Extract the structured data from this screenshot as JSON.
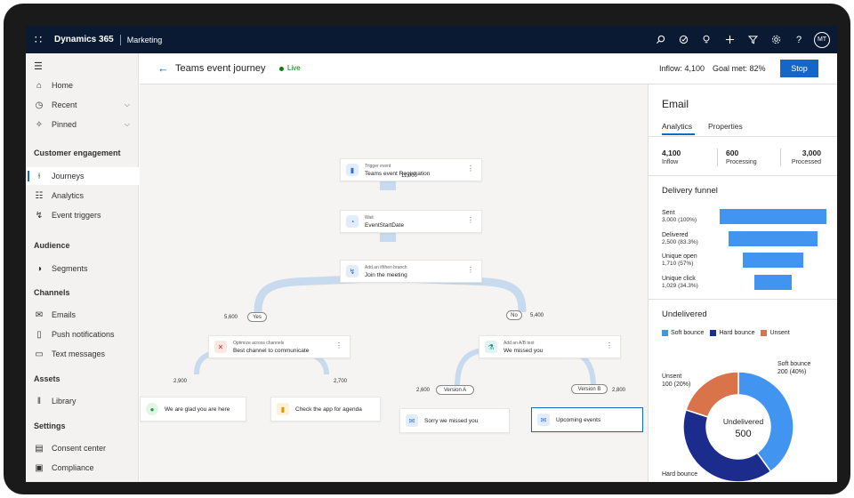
{
  "topbar": {
    "brand": "Dynamics 365",
    "module": "Marketing",
    "avatar_initials": "MT",
    "icons": [
      "search-icon",
      "goals-icon",
      "lightbulb-icon",
      "plus-icon",
      "filter-icon",
      "gear-icon",
      "help-icon"
    ]
  },
  "sidebar": {
    "items_top": [
      {
        "label": "Home",
        "icon": "home-icon"
      },
      {
        "label": "Recent",
        "icon": "clock-icon"
      },
      {
        "label": "Pinned",
        "icon": "pin-icon"
      }
    ],
    "sections": [
      {
        "title": "Customer engagement",
        "items": [
          {
            "label": "Journeys",
            "icon": "journey-icon"
          },
          {
            "label": "Analytics",
            "icon": "analytics-icon"
          },
          {
            "label": "Event triggers",
            "icon": "trigger-icon"
          }
        ]
      },
      {
        "title": "Audience",
        "items": [
          {
            "label": "Segments",
            "icon": "segments-icon"
          }
        ]
      },
      {
        "title": "Channels",
        "items": [
          {
            "label": "Emails",
            "icon": "mail-icon"
          },
          {
            "label": "Push notifications",
            "icon": "phone-icon"
          },
          {
            "label": "Text messages",
            "icon": "chat-icon"
          }
        ]
      },
      {
        "title": "Assets",
        "items": [
          {
            "label": "Library",
            "icon": "library-icon"
          }
        ]
      },
      {
        "title": "Settings",
        "items": [
          {
            "label": "Consent center",
            "icon": "consent-icon"
          },
          {
            "label": "Compliance",
            "icon": "compliance-icon"
          }
        ]
      }
    ]
  },
  "header": {
    "title": "Teams event journey",
    "status": "Live",
    "inflow": "Inflow: 4,100",
    "goal": "Goal met: 82%",
    "stop_label": "Stop"
  },
  "journey": {
    "nodes": {
      "trigger": {
        "label": "Trigger event",
        "name": "Teams event Registration"
      },
      "wait": {
        "label": "Wait",
        "name": "EventStartDate"
      },
      "branch": {
        "label": "Add an if/then branch",
        "name": "Join the meeting"
      },
      "optimize": {
        "label": "Optimize across channels",
        "name": "Best channel to communicate"
      },
      "abtest": {
        "label": "Add an A/B test",
        "name": "We missed you"
      },
      "glad": {
        "name": "We are glad you are here"
      },
      "app": {
        "name": "Check the app for agenda"
      },
      "sorry": {
        "name": "Sorry we missed you"
      },
      "upcoming": {
        "name": "Upcoming events"
      }
    },
    "counts": {
      "wait": "11,000",
      "yes": "5,600",
      "no": "5,400",
      "glad": "2,900",
      "app": "2,700",
      "version_a": "2,600",
      "version_b": "2,800"
    },
    "pills": {
      "yes": "Yes",
      "no": "No",
      "version_a": "Version A",
      "version_b": "Version B"
    }
  },
  "panel": {
    "title": "Email",
    "tabs": [
      "Analytics",
      "Properties"
    ],
    "metrics": [
      {
        "value": "4,100",
        "label": "Inflow"
      },
      {
        "value": "600",
        "label": "Processing"
      },
      {
        "value": "3,000",
        "label": "Processed"
      }
    ],
    "funnel": {
      "title": "Delivery funnel",
      "rows": [
        {
          "label": "Sent",
          "sub": "3,000 (100%)",
          "fraction": 1.0
        },
        {
          "label": "Delivered",
          "sub": "2,500 (83.3%)",
          "fraction": 0.833
        },
        {
          "label": "Unique open",
          "sub": "1,710 (57%)",
          "fraction": 0.57
        },
        {
          "label": "Unique click",
          "sub": "1,029 (34.3%)",
          "fraction": 0.343
        }
      ]
    },
    "undelivered": {
      "title": "Undelivered",
      "legend": [
        {
          "name": "Soft bounce",
          "color": "#4194f0"
        },
        {
          "name": "Hard bounce",
          "color": "#1c2c8c"
        },
        {
          "name": "Unsent",
          "color": "#d8734a"
        }
      ],
      "center_label": "Undelivered",
      "center_value": "500",
      "labels": {
        "soft": "Soft bounce",
        "soft_val": "200 (40%)",
        "unsent": "Unsent",
        "unsent_val": "100 (20%)",
        "hard": "Hard bounce"
      }
    }
  },
  "chart_data": {
    "type": "pie",
    "title": "Undelivered",
    "categories": [
      "Soft bounce",
      "Hard bounce",
      "Unsent"
    ],
    "values": [
      200,
      200,
      100
    ],
    "total": 500
  }
}
